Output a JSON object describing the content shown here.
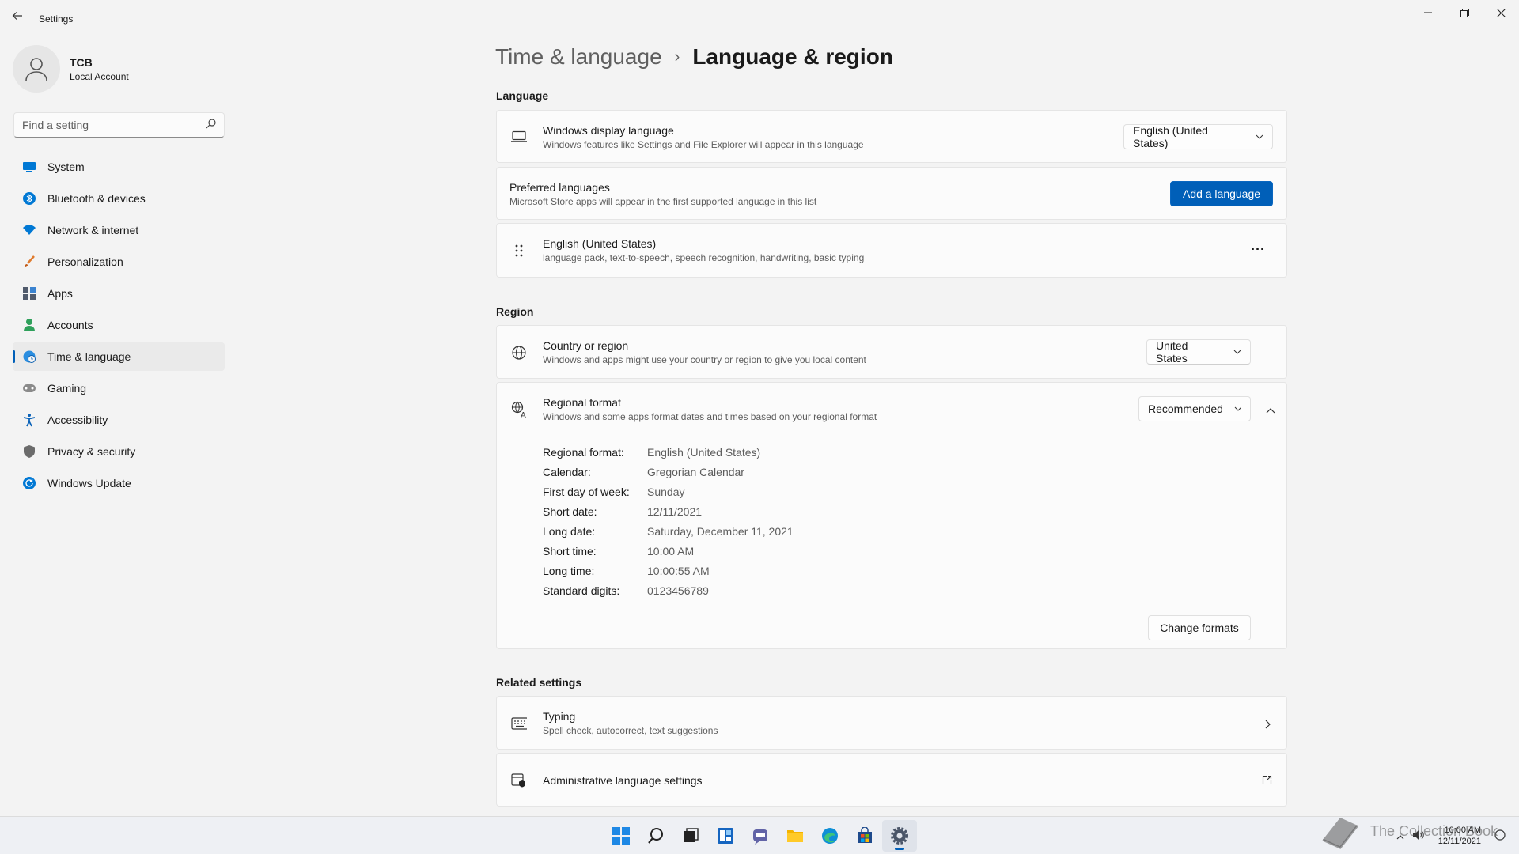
{
  "window": {
    "title": "Settings",
    "controls": {
      "minimize": "—",
      "maximize": "❐",
      "close": "✕"
    }
  },
  "profile": {
    "name": "TCB",
    "account_type": "Local Account"
  },
  "search": {
    "placeholder": "Find a setting"
  },
  "sidebar": {
    "items": [
      {
        "label": "System",
        "icon": "system-icon",
        "color": "#0078d4"
      },
      {
        "label": "Bluetooth & devices",
        "icon": "bluetooth-icon",
        "color": "#0078d4"
      },
      {
        "label": "Network & internet",
        "icon": "wifi-icon",
        "color": "#0078d4"
      },
      {
        "label": "Personalization",
        "icon": "brush-icon",
        "color": "#e07b2e"
      },
      {
        "label": "Apps",
        "icon": "apps-icon",
        "color": "#505a6b"
      },
      {
        "label": "Accounts",
        "icon": "person-icon",
        "color": "#2fa05b"
      },
      {
        "label": "Time & language",
        "icon": "globe-clock-icon",
        "color": "#0078d4"
      },
      {
        "label": "Gaming",
        "icon": "gamepad-icon",
        "color": "#737373"
      },
      {
        "label": "Accessibility",
        "icon": "accessibility-icon",
        "color": "#0a62b8"
      },
      {
        "label": "Privacy & security",
        "icon": "shield-icon",
        "color": "#6b6b6b"
      },
      {
        "label": "Windows Update",
        "icon": "update-icon",
        "color": "#0078d4"
      }
    ],
    "active_index": 6
  },
  "breadcrumb": {
    "parent": "Time & language",
    "separator": "›",
    "current": "Language & region"
  },
  "language": {
    "section_title": "Language",
    "display_language": {
      "title": "Windows display language",
      "subtitle": "Windows features like Settings and File Explorer will appear in this language",
      "value": "English (United States)"
    },
    "preferred": {
      "title": "Preferred languages",
      "subtitle": "Microsoft Store apps will appear in the first supported language in this list",
      "button": "Add a language"
    },
    "installed": {
      "title": "English (United States)",
      "subtitle": "language pack, text-to-speech, speech recognition, handwriting, basic typing",
      "more": "···"
    }
  },
  "region": {
    "section_title": "Region",
    "country": {
      "title": "Country or region",
      "subtitle": "Windows and apps might use your country or region to give you local content",
      "value": "United States"
    },
    "format": {
      "title": "Regional format",
      "subtitle": "Windows and some apps format dates and times based on your regional format",
      "value": "Recommended",
      "details": [
        {
          "label": "Regional format:",
          "value": "English (United States)"
        },
        {
          "label": "Calendar:",
          "value": "Gregorian Calendar"
        },
        {
          "label": "First day of week:",
          "value": "Sunday"
        },
        {
          "label": "Short date:",
          "value": "12/11/2021"
        },
        {
          "label": "Long date:",
          "value": "Saturday, December 11, 2021"
        },
        {
          "label": "Short time:",
          "value": "10:00 AM"
        },
        {
          "label": "Long time:",
          "value": "10:00:55 AM"
        },
        {
          "label": "Standard digits:",
          "value": "0123456789"
        }
      ],
      "change_button": "Change formats"
    }
  },
  "related": {
    "section_title": "Related settings",
    "typing": {
      "title": "Typing",
      "subtitle": "Spell check, autocorrect, text suggestions"
    },
    "admin": {
      "title": "Administrative language settings"
    }
  },
  "taskbar": {
    "apps": [
      "start-icon",
      "search-icon",
      "task-view-icon",
      "widgets-icon",
      "chat-icon",
      "file-explorer-icon",
      "edge-icon",
      "store-icon",
      "settings-icon"
    ],
    "clock_time": "10:00 AM",
    "clock_date": "12/11/2021",
    "accent": "#005fb8"
  },
  "watermark": {
    "text": "The Collection Book"
  }
}
